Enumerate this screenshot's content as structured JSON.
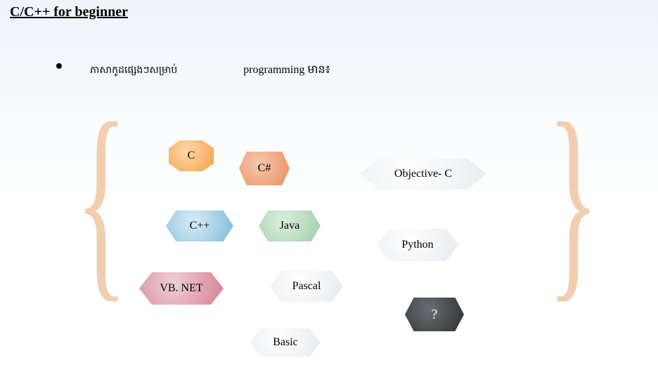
{
  "title": "C/C++ for beginner",
  "bullet": {
    "text1": "ភាសាកូដផ្សេងៗសម្រាប់",
    "text2": "programming មាន៖"
  },
  "shapes": {
    "c": "C",
    "csharp": "C#",
    "objc": "Objective- C",
    "cpp": "C++",
    "java": "Java",
    "python": "Python",
    "vbnet": "VB. NET",
    "pascal": "Pascal",
    "q": "?",
    "basic": "Basic"
  }
}
